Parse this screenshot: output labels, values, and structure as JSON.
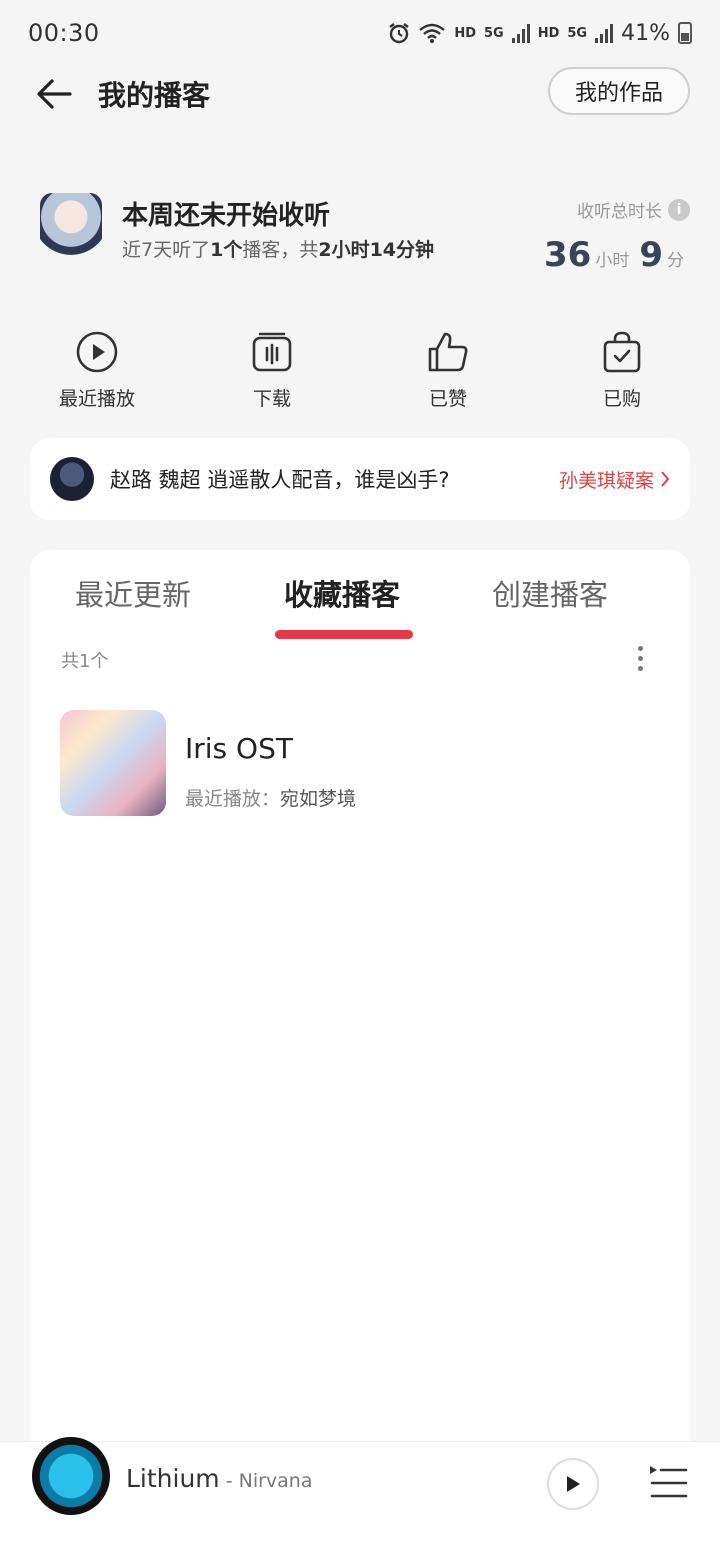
{
  "status_bar": {
    "time": "00:30",
    "hd1": "HD",
    "net1": "5G",
    "hd2": "HD",
    "net2": "5G",
    "battery": "41%"
  },
  "header": {
    "title": "我的播客",
    "works_button": "我的作品"
  },
  "profile": {
    "week_title": "本周还未开始收听",
    "week_sub_prefix": "近7天听了",
    "week_sub_count": "1个",
    "week_sub_mid": "播客，共",
    "week_sub_duration": "2小时14分钟",
    "total_label": "收听总时长",
    "total_hours": "36",
    "hours_unit": "小时",
    "total_minutes": "9",
    "minutes_unit": "分"
  },
  "quick_actions": [
    {
      "label": "最近播放",
      "icon": "play-circle-icon"
    },
    {
      "label": "下载",
      "icon": "download-icon"
    },
    {
      "label": "已赞",
      "icon": "thumbs-up-icon"
    },
    {
      "label": "已购",
      "icon": "purchased-bag-icon"
    }
  ],
  "now_playing_card": {
    "text": "赵路 魏超 逍遥散人配音，谁是凶手?",
    "link": "孙美琪疑案"
  },
  "tabs": [
    {
      "label": "最近更新",
      "active": false
    },
    {
      "label": "收藏播客",
      "active": true
    },
    {
      "label": "创建播客",
      "active": false
    }
  ],
  "list": {
    "count": "共1个",
    "items": [
      {
        "title": "Iris OST",
        "sub_label": "最近播放：",
        "sub_value": "宛如梦境"
      }
    ]
  },
  "player": {
    "song": "Lithium",
    "separator": " - ",
    "artist": "Nirvana"
  },
  "colors": {
    "accent_red": "#e8374b",
    "link_red": "#e0413f",
    "background": "#f5f5f6"
  }
}
